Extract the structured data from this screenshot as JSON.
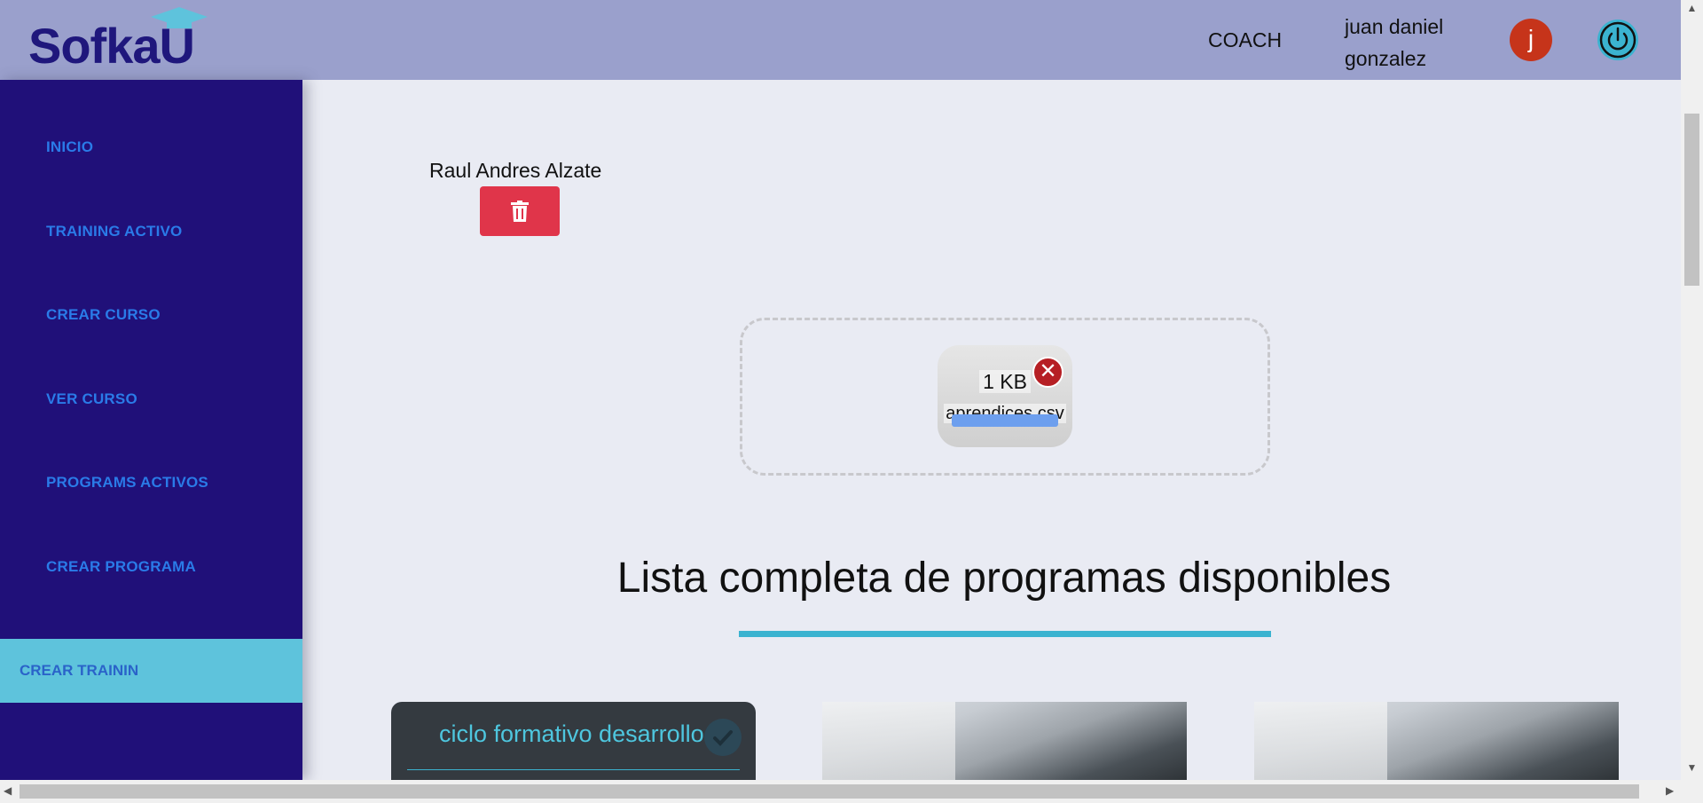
{
  "header": {
    "logo_text": "SofkaU",
    "role": "COACH",
    "username": "juan daniel gonzalez",
    "avatar_initial": "j",
    "colors": {
      "background": "#9aa0cc",
      "logo": "#1f177c",
      "avatar": "#c6341a",
      "power_icon": "#3bb3d0"
    }
  },
  "sidebar": {
    "items": [
      {
        "label": "INICIO"
      },
      {
        "label": "TRAINING ACTIVO"
      },
      {
        "label": "CREAR CURSO"
      },
      {
        "label": "VER CURSO"
      },
      {
        "label": "PROGRAMS ACTIVOS"
      },
      {
        "label": "CREAR PROGRAMA"
      },
      {
        "label": "CREAR TRAININ",
        "active": true
      }
    ],
    "colors": {
      "background": "#201079",
      "text": "#2a7be8",
      "active_background": "#5ec3dc"
    }
  },
  "main": {
    "student": {
      "name": "Raul Andres Alzate",
      "delete_icon": "trash-icon"
    },
    "upload": {
      "file_size": "1 KB",
      "file_name": "aprendices.csv",
      "remove_icon": "close-icon"
    },
    "programs": {
      "title": "Lista completa de programas disponibles",
      "cards": [
        {
          "title": "ciclo formativo desarrollo",
          "icon": "check-icon"
        },
        {
          "title": ""
        },
        {
          "title": ""
        }
      ]
    }
  }
}
